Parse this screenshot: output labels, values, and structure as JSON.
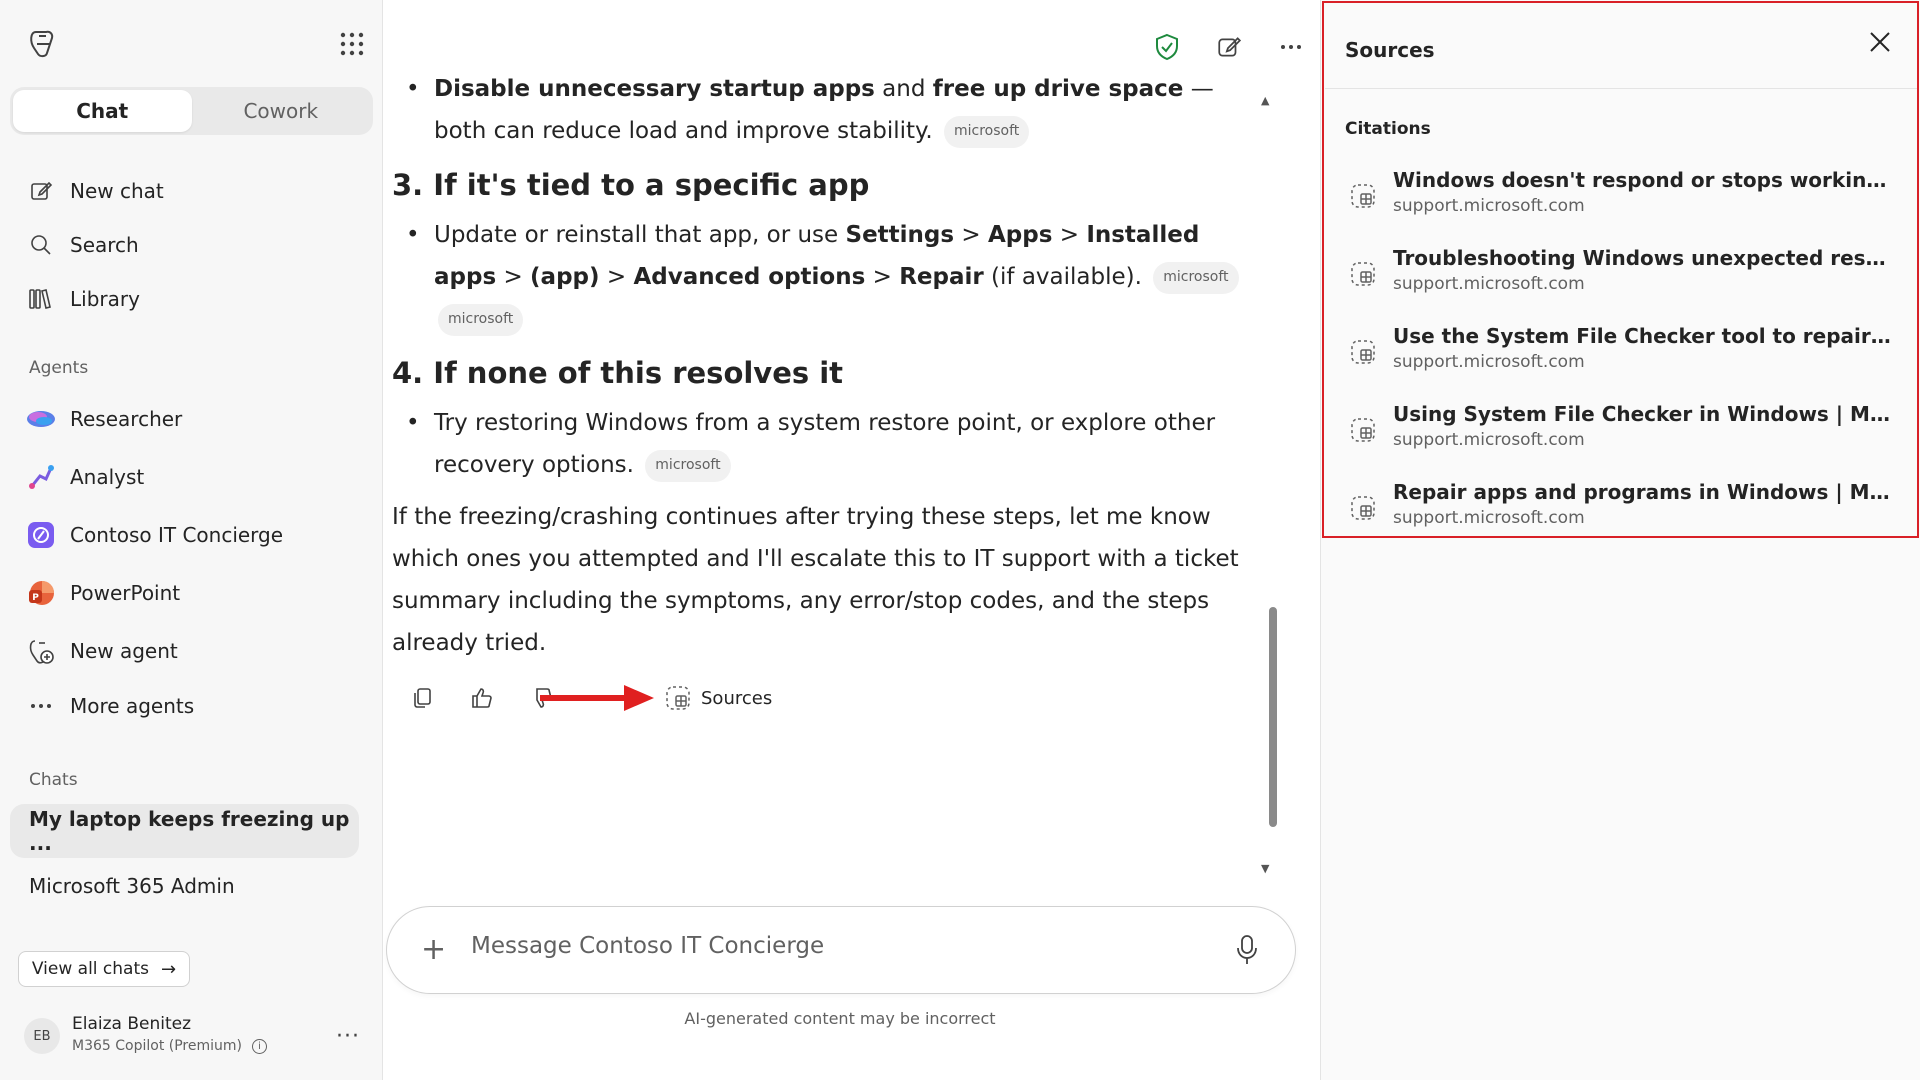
{
  "sidebar": {
    "tabs": [
      {
        "label": "Chat",
        "active": true
      },
      {
        "label": "Cowork",
        "active": false
      }
    ],
    "nav": {
      "new_chat": "New chat",
      "search": "Search",
      "library": "Library"
    },
    "agents_heading": "Agents",
    "agents": [
      {
        "label": "Researcher",
        "icon": "researcher-icon"
      },
      {
        "label": "Analyst",
        "icon": "analyst-icon"
      },
      {
        "label": "Contoso IT Concierge",
        "icon": "contoso-icon"
      },
      {
        "label": "PowerPoint",
        "icon": "powerpoint-icon"
      },
      {
        "label": "New agent",
        "icon": "new-agent-icon"
      },
      {
        "label": "More agents",
        "icon": "more-icon"
      }
    ],
    "chats_heading": "Chats",
    "chats": [
      {
        "label": "My laptop keeps freezing up ...",
        "selected": true
      },
      {
        "label": "Microsoft 365 Admin",
        "selected": false
      }
    ],
    "view_all": "View all chats",
    "user": {
      "initials": "EB",
      "name": "Elaiza Benitez",
      "plan": "M365 Copilot (Premium)"
    }
  },
  "message": {
    "bullet_top_bold1": "Disable unnecessary startup apps",
    "bullet_top_mid": " and ",
    "bullet_top_bold2": "free up drive space",
    "bullet_top_end": " — both can reduce load and improve stability.",
    "chip": "microsoft",
    "h3": "3. If it's tied to a specific app",
    "b3_pre": "Update or reinstall that app, or use ",
    "b3_settings": "Settings",
    "b3_sep": " > ",
    "b3_apps": "Apps",
    "b3_installed": "Installed apps",
    "b3_app": "(app)",
    "b3_adv": "Advanced options",
    "b3_repair": "Repair",
    "b3_post": " (if available).",
    "h4": "4. If none of this resolves it",
    "b4": "Try restoring Windows from a system restore point, or explore other recovery options.",
    "final": "If the freezing/crashing continues after trying these steps, let me know which ones you attempted and I'll escalate this to IT support with a ticket summary including the symptoms, any error/stop codes, and the steps already tried."
  },
  "actions": {
    "sources_label": "Sources"
  },
  "composer": {
    "placeholder": "Message Contoso IT Concierge",
    "disclaimer": "AI-generated content may be incorrect"
  },
  "sources_panel": {
    "title": "Sources",
    "citations_heading": "Citations",
    "citations": [
      {
        "title": "Windows doesn't respond or stops working on Su...",
        "domain": "support.microsoft.com"
      },
      {
        "title": "Troubleshooting Windows unexpected restarts an...",
        "domain": "support.microsoft.com"
      },
      {
        "title": "Use the System File Checker tool to repair missing ...",
        "domain": "support.microsoft.com"
      },
      {
        "title": "Using System File Checker in Windows | Microsoft ...",
        "domain": "support.microsoft.com"
      },
      {
        "title": "Repair apps and programs in Windows | Microsoft...",
        "domain": "support.microsoft.com"
      }
    ],
    "highlight_color": "#d92027"
  },
  "colors": {
    "annotation_arrow": "#e02020",
    "shield_green": "#1e8a3e"
  }
}
